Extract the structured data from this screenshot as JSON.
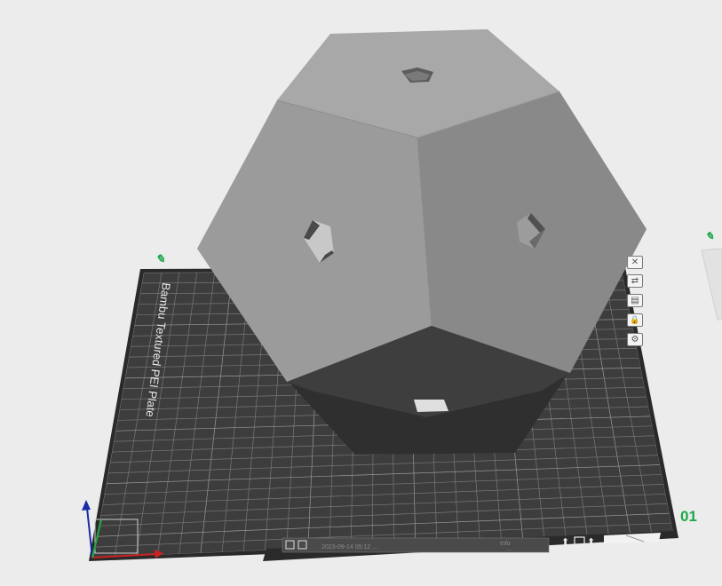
{
  "plate": {
    "name": "Bambu Textured PEI Plate",
    "number": "01",
    "bottom_text": "2023-09-14 05:12 ...",
    "bottom_subtext": "Info",
    "bottom_subtext2": "..."
  },
  "colors": {
    "background": "#ececec",
    "plate": "#3b3b3b",
    "grid": "#9a9a9a",
    "accent_green": "#1aa84a",
    "model_top": "#a9a9a9",
    "model_left": "#9d9d9d",
    "model_right": "#8a8a8a"
  },
  "toolbar": {
    "buttons": [
      {
        "name": "arrange-icon",
        "glyph": "✕"
      },
      {
        "name": "orient-icon",
        "glyph": "⇄"
      },
      {
        "name": "layout-icon",
        "glyph": "▤"
      },
      {
        "name": "lock-icon",
        "glyph": "🔒"
      },
      {
        "name": "settings-icon",
        "glyph": "⚙"
      }
    ]
  }
}
